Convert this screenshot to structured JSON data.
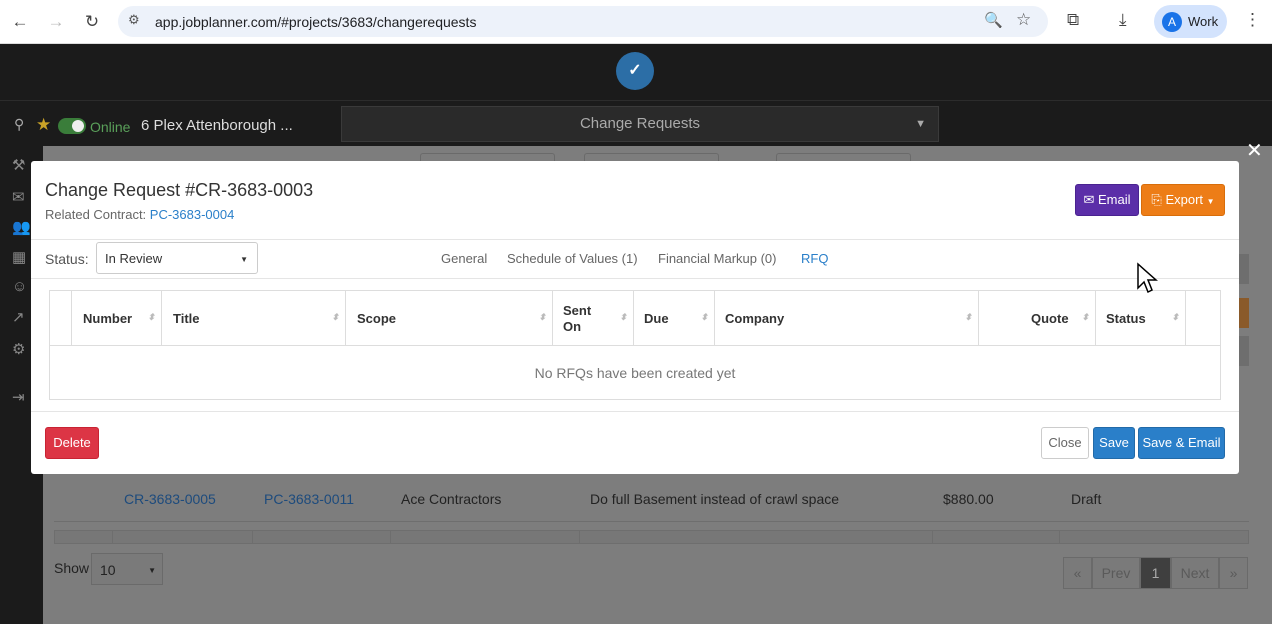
{
  "browser": {
    "url": "app.jobplanner.com/#projects/3683/changerequests",
    "profile_initial": "A",
    "profile_label": "Work"
  },
  "app": {
    "online_label": "Online",
    "project_name": "6 Plex Attenborough ...",
    "section_select": "Change Requests"
  },
  "background": {
    "row": {
      "number": "CR-3683-0005",
      "contract": "PC-3683-0011",
      "company": "Ace Contractors",
      "title": "Do full Basement instead of crawl space",
      "amount": "$880.00",
      "status": "Draft"
    },
    "show_label": "Show",
    "page_size": "10",
    "pagination": {
      "first": "«",
      "prev": "Prev",
      "current": "1",
      "next": "Next",
      "last": "»"
    }
  },
  "modal": {
    "title": "Change Request #CR-3683-0003",
    "related_label": "Related Contract:",
    "related_contract": "PC-3683-0004",
    "email_label": "Email",
    "export_label": "Export",
    "status_label": "Status:",
    "status_value": "In Review",
    "tabs": [
      {
        "label": "General"
      },
      {
        "label": "Schedule of Values (1)"
      },
      {
        "label": "Financial Markup (0)"
      },
      {
        "label": "RFQ"
      }
    ],
    "active_tab": "RFQ",
    "table": {
      "columns": [
        "Number",
        "Title",
        "Scope",
        "Sent On",
        "Due",
        "Company",
        "Quote",
        "Status"
      ],
      "empty_text": "No RFQs have been created yet"
    },
    "buttons": {
      "delete": "Delete",
      "close": "Close",
      "save": "Save",
      "save_email": "Save & Email"
    }
  },
  "colors": {
    "primary": "#2a7fc9",
    "email_button": "#5b2ea8",
    "export_button": "#ed7d17",
    "delete_button": "#dc3545",
    "online_green": "#5aa05a"
  }
}
